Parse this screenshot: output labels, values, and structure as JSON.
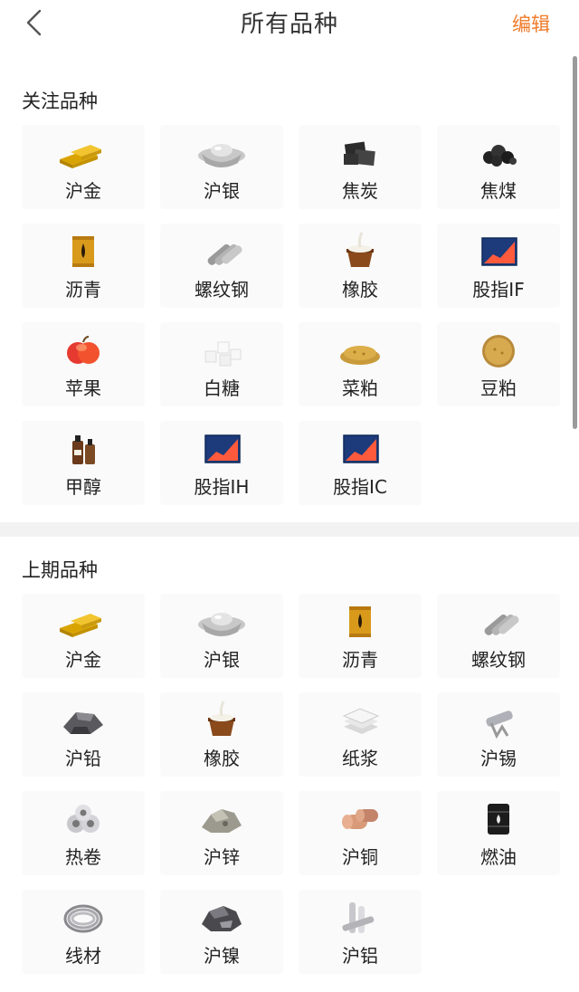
{
  "header": {
    "title": "所有品种",
    "edit_label": "编辑"
  },
  "sections": [
    {
      "title": "关注品种",
      "items": [
        {
          "label": "沪金",
          "icon": "gold-bars-icon"
        },
        {
          "label": "沪银",
          "icon": "silver-ingot-icon"
        },
        {
          "label": "焦炭",
          "icon": "coke-icon"
        },
        {
          "label": "焦煤",
          "icon": "coal-icon"
        },
        {
          "label": "沥青",
          "icon": "asphalt-barrel-icon"
        },
        {
          "label": "螺纹钢",
          "icon": "rebar-icon"
        },
        {
          "label": "橡胶",
          "icon": "rubber-bucket-icon"
        },
        {
          "label": "股指IF",
          "icon": "index-chart-icon"
        },
        {
          "label": "苹果",
          "icon": "apple-icon"
        },
        {
          "label": "白糖",
          "icon": "sugar-cubes-icon"
        },
        {
          "label": "菜粕",
          "icon": "rapeseed-meal-icon"
        },
        {
          "label": "豆粕",
          "icon": "soybean-meal-icon"
        },
        {
          "label": "甲醇",
          "icon": "methanol-bottles-icon"
        },
        {
          "label": "股指IH",
          "icon": "index-chart-icon"
        },
        {
          "label": "股指IC",
          "icon": "index-chart-icon"
        }
      ]
    },
    {
      "title": "上期品种",
      "items": [
        {
          "label": "沪金",
          "icon": "gold-bars-icon"
        },
        {
          "label": "沪银",
          "icon": "silver-ingot-icon"
        },
        {
          "label": "沥青",
          "icon": "asphalt-barrel-icon"
        },
        {
          "label": "螺纹钢",
          "icon": "rebar-icon"
        },
        {
          "label": "沪铅",
          "icon": "lead-ore-icon"
        },
        {
          "label": "橡胶",
          "icon": "rubber-bucket-icon"
        },
        {
          "label": "纸浆",
          "icon": "pulp-sheets-icon"
        },
        {
          "label": "沪锡",
          "icon": "tin-icon"
        },
        {
          "label": "热卷",
          "icon": "steel-coils-icon"
        },
        {
          "label": "沪锌",
          "icon": "zinc-ore-icon"
        },
        {
          "label": "沪铜",
          "icon": "copper-coils-icon"
        },
        {
          "label": "燃油",
          "icon": "oil-barrel-icon"
        },
        {
          "label": "线材",
          "icon": "wire-coil-icon"
        },
        {
          "label": "沪镍",
          "icon": "nickel-ore-icon"
        },
        {
          "label": "沪铝",
          "icon": "aluminum-rods-icon"
        }
      ]
    }
  ],
  "colors": {
    "accent": "#f07b2a",
    "tile_bg": "#fafafa",
    "divider": "#f2f2f2"
  }
}
